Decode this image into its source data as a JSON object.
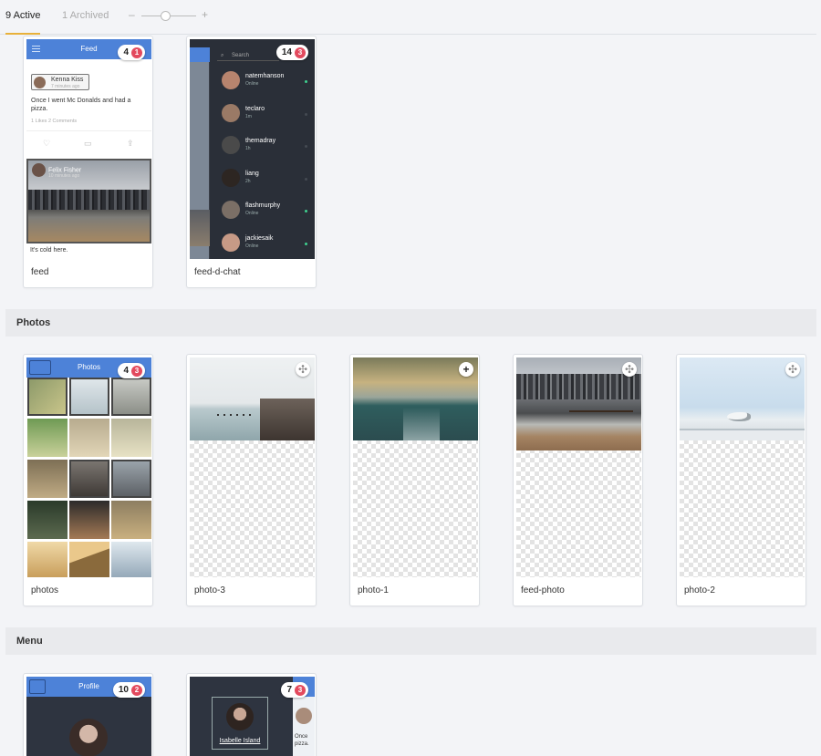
{
  "tabs": {
    "active": "9 Active",
    "archived": "1 Archived",
    "zoom_minus": "–",
    "zoom_plus": "+"
  },
  "sections": {
    "photos": "Photos",
    "menu": "Menu"
  },
  "feed_card": {
    "caption": "feed",
    "header_title": "Feed",
    "badge_count": "4",
    "badge_unread": "1",
    "post1_author": "Kenna Kiss",
    "post1_time": "7 minutes ago",
    "post1_text": "Once I went Mc Donalds and had a pizza.",
    "post1_meta": "1 Likes  2 Comments",
    "post2_author": "Felix Fisher",
    "post2_time": "10 minutes ago",
    "post2_text": "It's cold here."
  },
  "chat_card": {
    "caption": "feed-d-chat",
    "badge_count": "14",
    "badge_unread": "3",
    "search_placeholder": "Search",
    "contacts": [
      {
        "name": "natemhanson",
        "status": "Online",
        "online": true,
        "avatar": "#b7846e"
      },
      {
        "name": "teclaro",
        "status": "1m",
        "online": false,
        "avatar": "#9a7a66"
      },
      {
        "name": "themadray",
        "status": "1h",
        "online": false,
        "avatar": "#4a4a4a"
      },
      {
        "name": "liang",
        "status": "2h",
        "online": false,
        "avatar": "#2d2622"
      },
      {
        "name": "flashmurphy",
        "status": "Online",
        "online": true,
        "avatar": "#7b6f66"
      },
      {
        "name": "jackiesaik",
        "status": "Online",
        "online": true,
        "avatar": "#c79a86"
      }
    ]
  },
  "photos_card": {
    "caption": "photos",
    "header_title": "Photos",
    "badge_count": "4",
    "badge_unread": "3"
  },
  "photo_cards": [
    {
      "caption": "photo-3",
      "icon": "move-icon"
    },
    {
      "caption": "photo-1",
      "icon": "add-icon"
    },
    {
      "caption": "feed-photo",
      "icon": "move-icon"
    },
    {
      "caption": "photo-2",
      "icon": "move-icon"
    }
  ],
  "menu_cards": [
    {
      "header_title": "Profile",
      "badge_count": "10",
      "badge_unread": "2"
    },
    {
      "badge_count": "7",
      "badge_unread": "3",
      "profile_name": "Isabelle Island",
      "side_text": "Once pizza."
    }
  ],
  "colors": {
    "accent_tab": "#e8b13a",
    "app_blue": "#4d82d8",
    "badge_red": "#e34a5e",
    "online_green": "#3ecf8e"
  }
}
